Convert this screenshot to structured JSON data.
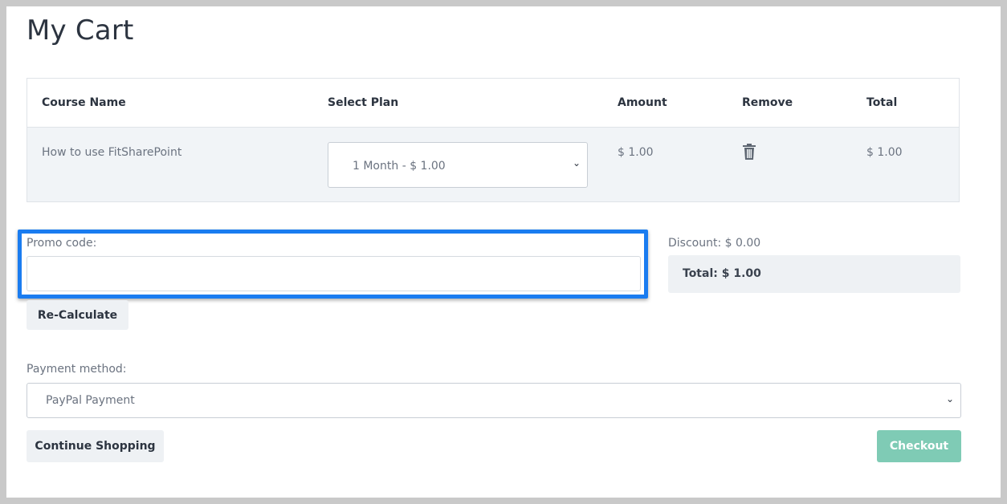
{
  "page": {
    "title": "My Cart"
  },
  "table": {
    "headers": [
      "Course Name",
      "Select Plan",
      "Amount",
      "Remove",
      "Total"
    ],
    "rows": [
      {
        "course": "How to use FitSharePoint",
        "plan": "1 Month - $ 1.00",
        "amount": "$ 1.00",
        "remove_icon": "trash-icon",
        "total": "$ 1.00"
      }
    ]
  },
  "promo": {
    "label": "Promo code:",
    "value": "",
    "recalc_label": "Re-Calculate"
  },
  "summary": {
    "discount": "Discount: $ 0.00",
    "total": "Total: $ 1.00"
  },
  "payment": {
    "label": "Payment method:",
    "selected": "PayPal Payment"
  },
  "actions": {
    "continue_label": "Continue Shopping",
    "checkout_label": "Checkout"
  },
  "colors": {
    "highlight": "#1a7cf0",
    "checkout": "#7fcbb5",
    "row_bg": "#f1f4f7"
  }
}
